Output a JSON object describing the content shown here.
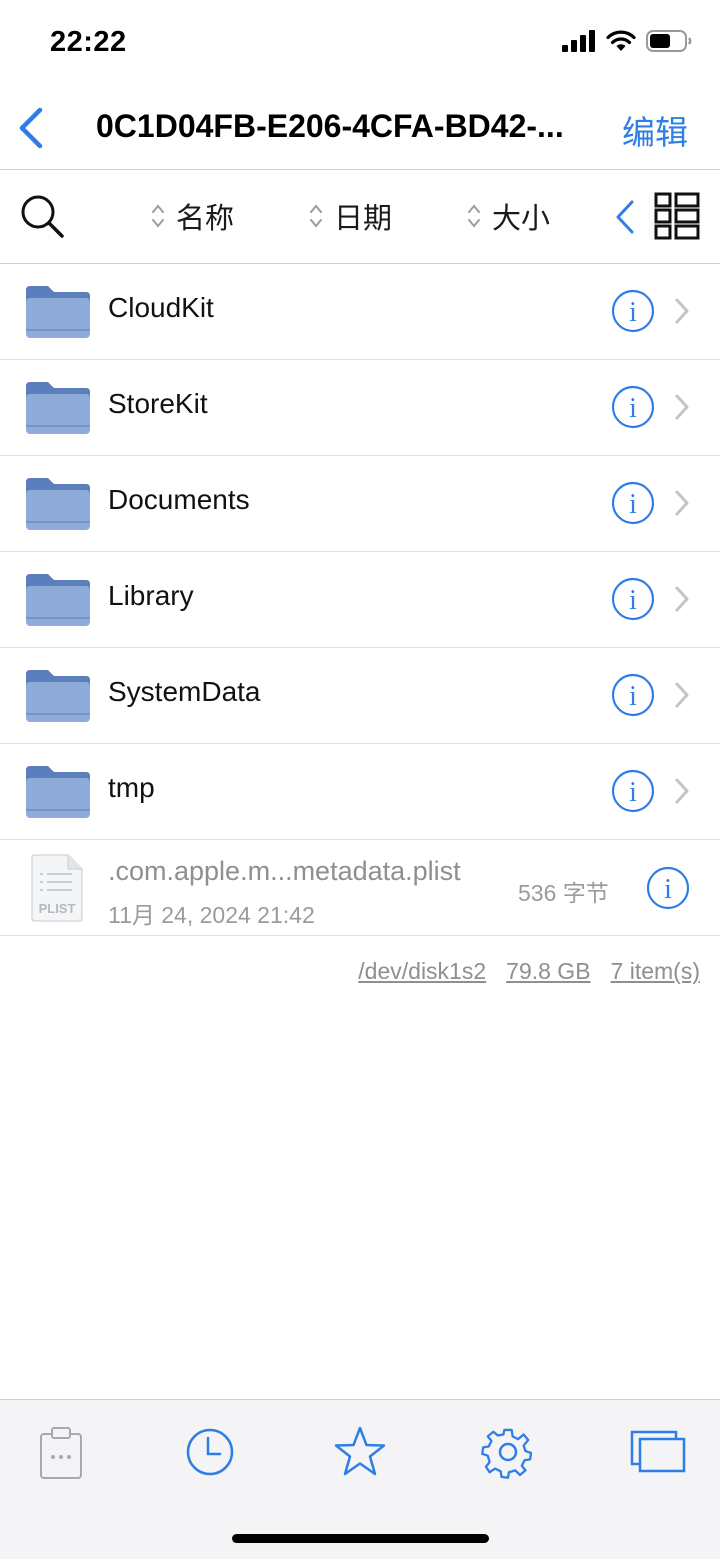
{
  "status_bar": {
    "time": "22:22"
  },
  "nav": {
    "title": "0C1D04FB-E206-4CFA-BD42-...",
    "edit_label": "编辑"
  },
  "sort": {
    "name_label": "名称",
    "date_label": "日期",
    "size_label": "大小"
  },
  "folders": [
    {
      "name": "CloudKit"
    },
    {
      "name": "StoreKit"
    },
    {
      "name": "Documents"
    },
    {
      "name": "Library"
    },
    {
      "name": "SystemData"
    },
    {
      "name": "tmp"
    }
  ],
  "file": {
    "name": ".com.apple.m...metadata.plist",
    "date": "11月 24, 2024 21:42",
    "size": "536 字节",
    "icon_label": "PLIST"
  },
  "footer": {
    "disk": "/dev/disk1s2",
    "free": "79.8 GB",
    "count": "7 item(s)"
  },
  "colors": {
    "accent": "#2f7ee6",
    "folder_front": "#8fabd9",
    "folder_back": "#5b7fbd"
  },
  "tabs": [
    "clipboard-icon",
    "clock-icon",
    "star-icon",
    "gear-icon",
    "windows-icon"
  ]
}
